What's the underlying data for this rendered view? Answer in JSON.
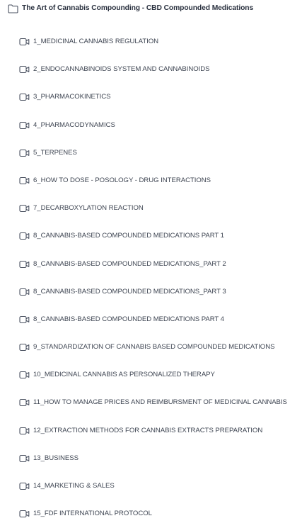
{
  "course": {
    "title": "The Art of Cannabis Compounding - CBD Compounded Medications",
    "icon": "folder-icon"
  },
  "lessons": [
    {
      "label": "1_MEDICINAL CANNABIS REGULATION",
      "icon": "video-icon"
    },
    {
      "label": "2_ENDOCANNABINOIDS SYSTEM AND CANNABINOIDS",
      "icon": "video-icon"
    },
    {
      "label": "3_PHARMACOKINETICS",
      "icon": "video-icon"
    },
    {
      "label": "4_PHARMACODYNAMICS",
      "icon": "video-icon"
    },
    {
      "label": "5_TERPENES",
      "icon": "video-icon"
    },
    {
      "label": "6_HOW TO DOSE - POSOLOGY - DRUG INTERACTIONS",
      "icon": "video-icon"
    },
    {
      "label": "7_DECARBOXYLATION REACTION",
      "icon": "video-icon"
    },
    {
      "label": "8_CANNABIS-BASED COMPOUNDED MEDICATIONS PART 1",
      "icon": "video-icon"
    },
    {
      "label": "8_CANNABIS-BASED COMPOUNDED MEDICATIONS_PART 2",
      "icon": "video-icon"
    },
    {
      "label": "8_CANNABIS-BASED COMPOUNDED MEDICATIONS_PART 3",
      "icon": "video-icon"
    },
    {
      "label": "8_CANNABIS-BASED COMPOUNDED MEDICATIONS PART 4",
      "icon": "video-icon"
    },
    {
      "label": "9_STANDARDIZATION OF CANNABIS BASED COMPOUNDED MEDICATIONS",
      "icon": "video-icon"
    },
    {
      "label": "10_MEDICINAL CANNABIS AS PERSONALIZED THERAPY",
      "icon": "video-icon"
    },
    {
      "label": "11_HOW TO MANAGE PRICES AND REIMBURSMENT OF MEDICINAL CANNABIS",
      "icon": "video-icon"
    },
    {
      "label": "12_EXTRACTION METHODS FOR CANNABIS EXTRACTS PREPARATION",
      "icon": "video-icon"
    },
    {
      "label": "13_BUSINESS",
      "icon": "video-icon"
    },
    {
      "label": "14_MARKETING & SALES",
      "icon": "video-icon"
    },
    {
      "label": "15_FDF INTERNATIONAL PROTOCOL",
      "icon": "video-icon"
    }
  ],
  "colors": {
    "text": "#3e4552",
    "icon_stroke": "#4a5160"
  }
}
